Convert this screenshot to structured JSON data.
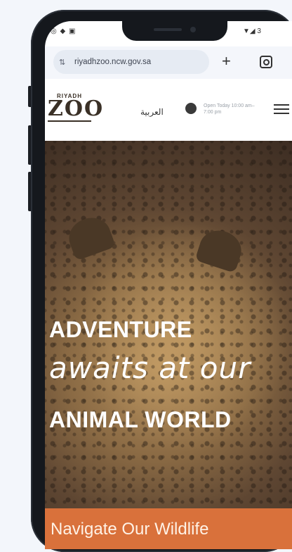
{
  "status_bar": {
    "left_icons": "◎ ◆ ▣",
    "right_icons": "▼◢ 3"
  },
  "browser": {
    "url": "riyadhzoo.ncw.gov.sa",
    "site_info_icon": "tune-icon",
    "new_tab_label": "+",
    "extra_icon": "instagram-icon"
  },
  "header": {
    "logo": {
      "top": "RIYADH",
      "main": "ZOO"
    },
    "language_link": "العربية",
    "hours_text": "Open Today 10:00 am–7:00 pm",
    "menu_icon": "hamburger-menu-icon"
  },
  "hero": {
    "line1": "ADVENTURE",
    "line2": "awaits at our",
    "line3": "ANIMAL WORLD",
    "cta_label": "Navigate Our Wildlife"
  }
}
